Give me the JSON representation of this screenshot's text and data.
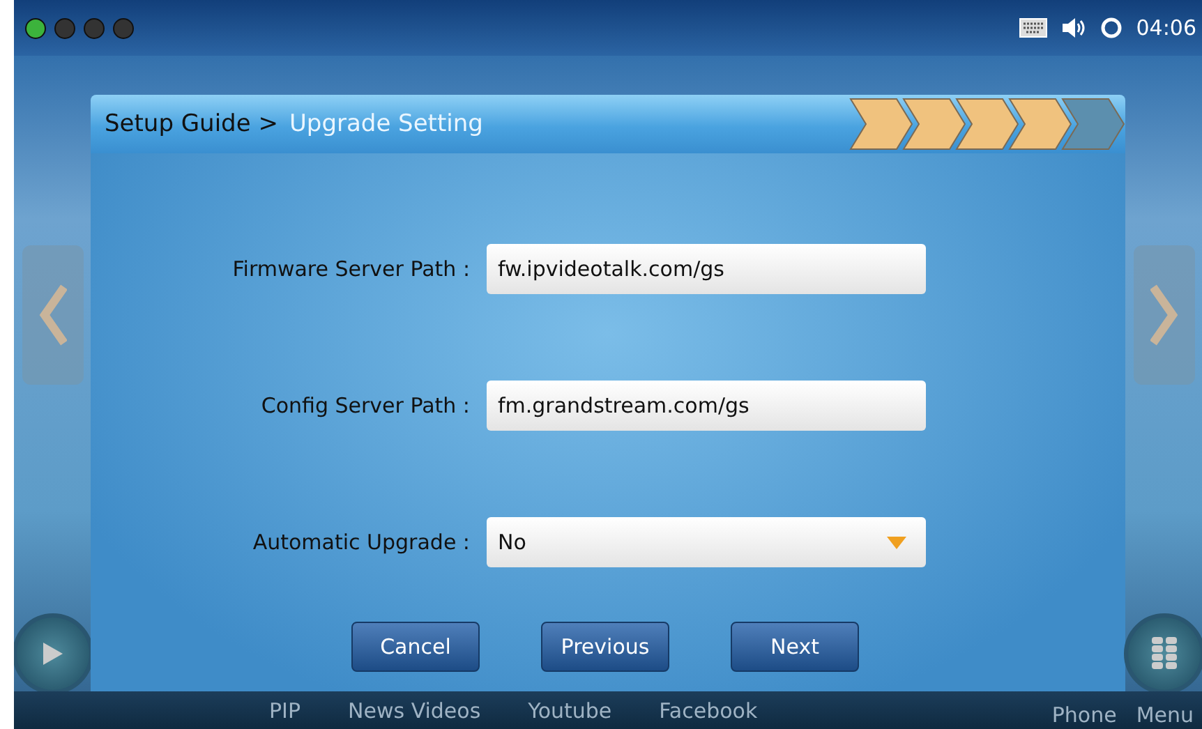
{
  "status_bar": {
    "page_dots": [
      {
        "selected": true
      },
      {
        "selected": false
      },
      {
        "selected": false
      },
      {
        "selected": false
      }
    ],
    "time": "04:06"
  },
  "dialog": {
    "breadcrumb": "Setup Guide >",
    "title": "Upgrade Setting",
    "steps": [
      {
        "done": true
      },
      {
        "done": true
      },
      {
        "done": true
      },
      {
        "done": true
      },
      {
        "done": false
      }
    ],
    "fields": [
      {
        "kind": "text",
        "label": "Firmware Server Path :",
        "value": "fw.ipvideotalk.com/gs"
      },
      {
        "kind": "text",
        "label": "Config Server Path :",
        "value": "fm.grandstream.com/gs"
      },
      {
        "kind": "select",
        "label": "Automatic Upgrade :",
        "value": "No"
      }
    ],
    "buttons": [
      "Cancel",
      "Previous",
      "Next"
    ]
  },
  "dock": {
    "items": [
      "PIP",
      "News Videos",
      "Youtube",
      "Facebook"
    ],
    "right_items": [
      "Phone",
      "Menu"
    ]
  }
}
